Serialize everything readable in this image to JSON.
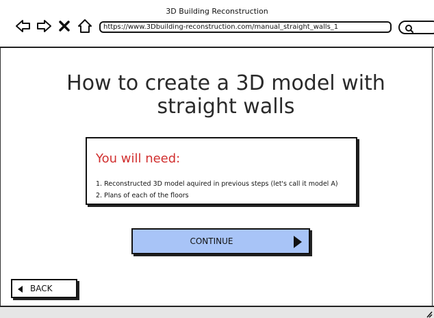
{
  "window": {
    "title": "3D Building Reconstruction"
  },
  "browser": {
    "url": "https://www.3Dbuilding-reconstruction.com/manual_straight_walls_1",
    "icons": [
      "back-arrow-icon",
      "forward-arrow-icon",
      "close-icon",
      "home-icon",
      "search-icon"
    ]
  },
  "main": {
    "title": "How to create a 3D model with straight walls",
    "needs": {
      "heading": "You will need:",
      "heading_color": "#d12f2f",
      "items": [
        "1. Reconstructed 3D model aquired in previous steps (let's call it model A)",
        "2. Plans of each of the floors"
      ]
    },
    "continue_label": "CONTINUE",
    "continue_color": "#a8c4f7",
    "back_label": "BACK"
  }
}
